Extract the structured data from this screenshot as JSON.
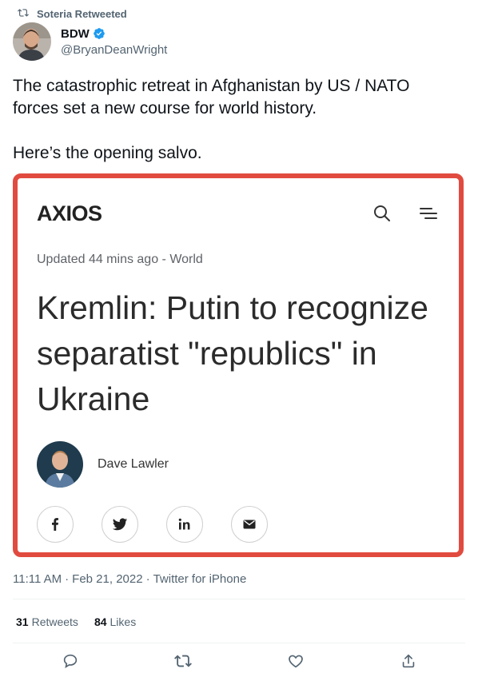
{
  "retweet_context": {
    "label": "Soteria Retweeted",
    "icon": "retweet-icon"
  },
  "author": {
    "display_name": "BDW",
    "handle": "@BryanDeanWright",
    "verified": true,
    "avatar_icon": "user-avatar"
  },
  "tweet_text": "The catastrophic retreat in Afghanistan by US / NATO\nforces set a new course for world history.\n\nHere’s the opening salvo.",
  "card": {
    "logo": "AXIOS",
    "search_icon": "search-icon",
    "menu_icon": "menu-icon",
    "meta": "Updated 44 mins ago - World",
    "title": "Kremlin: Putin to recognize separatist \"republics\" in Ukraine",
    "author_name": "Dave Lawler",
    "share_buttons": [
      "facebook-icon",
      "twitter-icon",
      "linkedin-icon",
      "mail-icon"
    ],
    "border_color": "#e14b3f"
  },
  "meta": {
    "time": "11:11 AM",
    "date": "Feb 21, 2022",
    "source": "Twitter for iPhone",
    "sep": "·"
  },
  "stats": {
    "retweets_count": "31",
    "retweets_label": "Retweets",
    "likes_count": "84",
    "likes_label": "Likes"
  },
  "actions": [
    "reply-icon",
    "retweet-icon",
    "like-icon",
    "share-icon"
  ],
  "colors": {
    "muted": "#536471",
    "verified": "#1d9bf0"
  }
}
